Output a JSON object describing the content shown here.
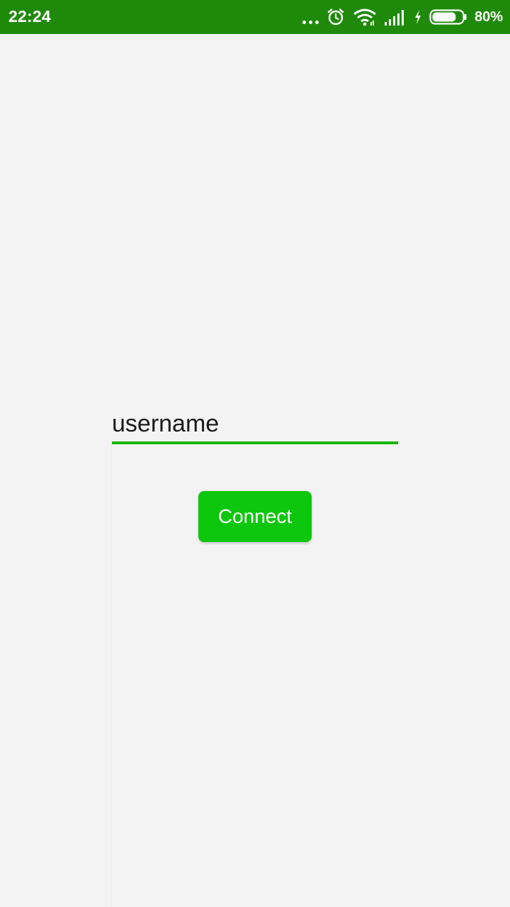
{
  "status_bar": {
    "time": "22:24",
    "battery_percent": "80%",
    "battery_level": 0.8,
    "background_color": "#1f8a0a",
    "icons": [
      "more-notifications-icon",
      "alarm-icon",
      "wifi-icon",
      "cellular-signal-icon",
      "charging-icon",
      "battery-icon"
    ]
  },
  "login": {
    "username_placeholder": "username",
    "username_value": "",
    "connect_label": "Connect"
  },
  "colors": {
    "accent": "#16b60c",
    "button": "#0cc70c",
    "background": "#f3f3f3"
  }
}
